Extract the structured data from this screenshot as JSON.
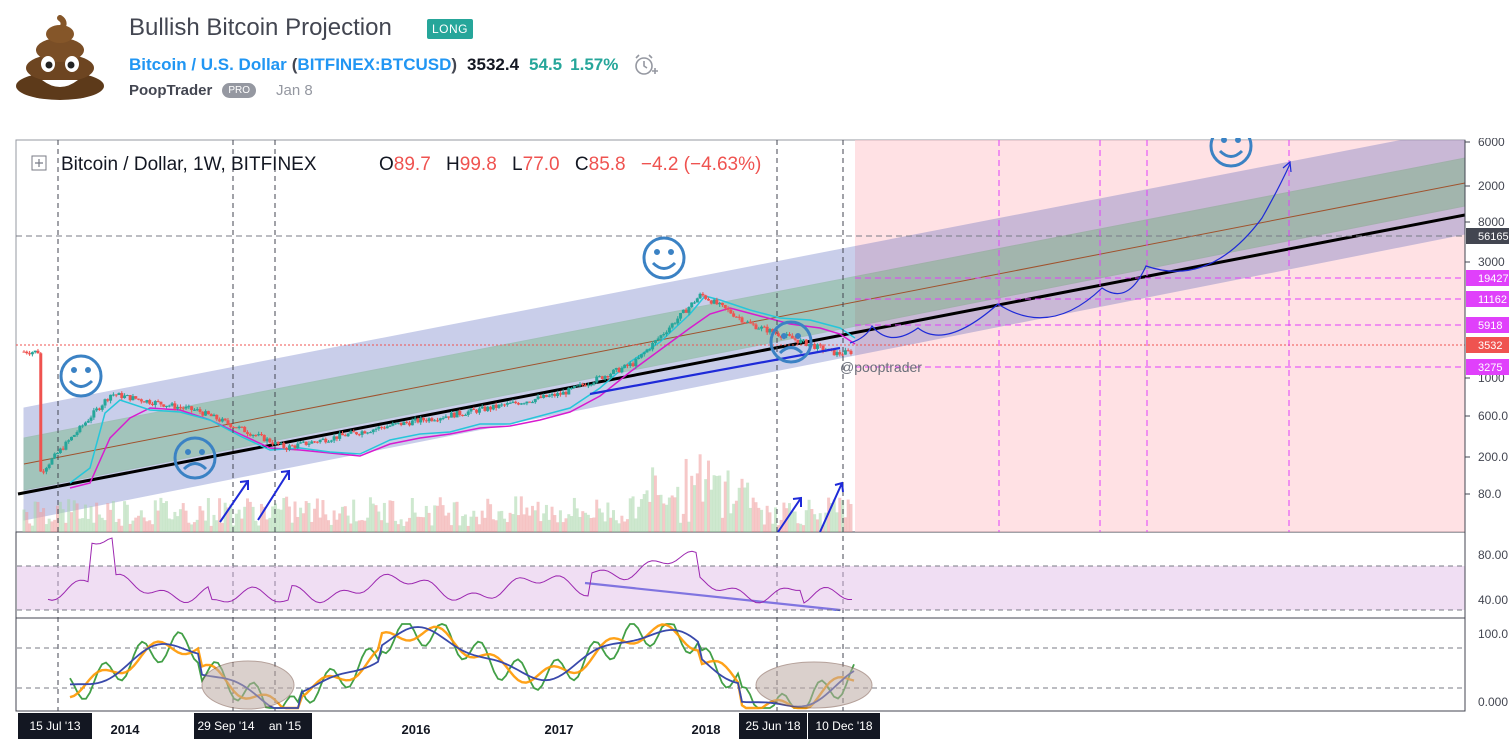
{
  "header": {
    "title": "Bullish Bitcoin Projection",
    "badge": "LONG",
    "symbol_name": "Bitcoin / U.S. Dollar",
    "paren_open": "(",
    "symbol_exchange": "BITFINEX:BTCUSD",
    "paren_close": ")",
    "price": "3532.4",
    "change": "54.5",
    "change_percent": "1.57%",
    "author": "PoopTrader",
    "author_badge": "PRO",
    "date": "Jan 8"
  },
  "legend": {
    "symbol": "Bitcoin / Dollar, 1W, BITFINEX",
    "o_label": "O",
    "o_value": "89.7",
    "h_label": "H",
    "h_value": "99.8",
    "l_label": "L",
    "l_value": "77.0",
    "c_label": "C",
    "c_value": "85.8",
    "change": "−4.2 (−4.63%)"
  },
  "watermark": "@pooptrader",
  "colors": {
    "up": "#26a69a",
    "down": "#ef5350",
    "channel_outer": "#3f51b5",
    "channel_inner": "#4caf50",
    "projection_zone": "#ffcdd2",
    "rsi_line": "#9c27b0",
    "stoch_k": "#4caf50",
    "stoch_d": "#ff9800",
    "annotation": "#1e2ad8"
  },
  "icons": [
    "happy-face-icon",
    "sad-face-icon",
    "up-arrow-icon",
    "alarm-add-icon",
    "expand-icon"
  ],
  "chart_data": [
    {
      "type": "line",
      "panel": "price",
      "scale": "log",
      "title": "Bitcoin / Dollar, 1W, BITFINEX",
      "x_tick_labels": [
        "2014",
        "2016",
        "2017",
        "2018"
      ],
      "date_markers": [
        "15 Jul '13",
        "29 Sep '14",
        "an '15",
        "25 Jun '18",
        "10 Dec '18"
      ],
      "y_tick_labels": [
        "6000",
        "2000",
        "8000",
        "3000",
        "600.0",
        "200.0",
        "80.0",
        "1000"
      ],
      "price_labels": [
        {
          "text": "56165",
          "color": "#434651"
        },
        {
          "text": "19427",
          "color": "#e040fb"
        },
        {
          "text": "11162",
          "color": "#e040fb"
        },
        {
          "text": "5918",
          "color": "#e040fb"
        },
        {
          "text": "3532",
          "color": "#ef5350"
        },
        {
          "text": "3275",
          "color": "#e040fb"
        }
      ],
      "series": [
        {
          "values": [
            [
              2013.4,
              90
            ],
            [
              2013.9,
              1000
            ],
            [
              2014.5,
              600
            ],
            [
              2015.1,
              200
            ],
            [
              2015.8,
              380
            ],
            [
              2016.5,
              650
            ],
            [
              2017.0,
              1000
            ],
            [
              2017.5,
              2500
            ],
            [
              2017.96,
              19500
            ],
            [
              2018.3,
              8000
            ],
            [
              2018.9,
              3300
            ],
            [
              2019.0,
              3532
            ]
          ]
        }
      ],
      "grid": false
    },
    {
      "type": "line",
      "panel": "rsi",
      "y_tick_labels": [
        "80.00",
        "40.00"
      ],
      "grid": false
    },
    {
      "type": "line",
      "panel": "stochastic",
      "y_tick_labels": [
        "100.0",
        "0.000"
      ],
      "grid": false
    }
  ]
}
